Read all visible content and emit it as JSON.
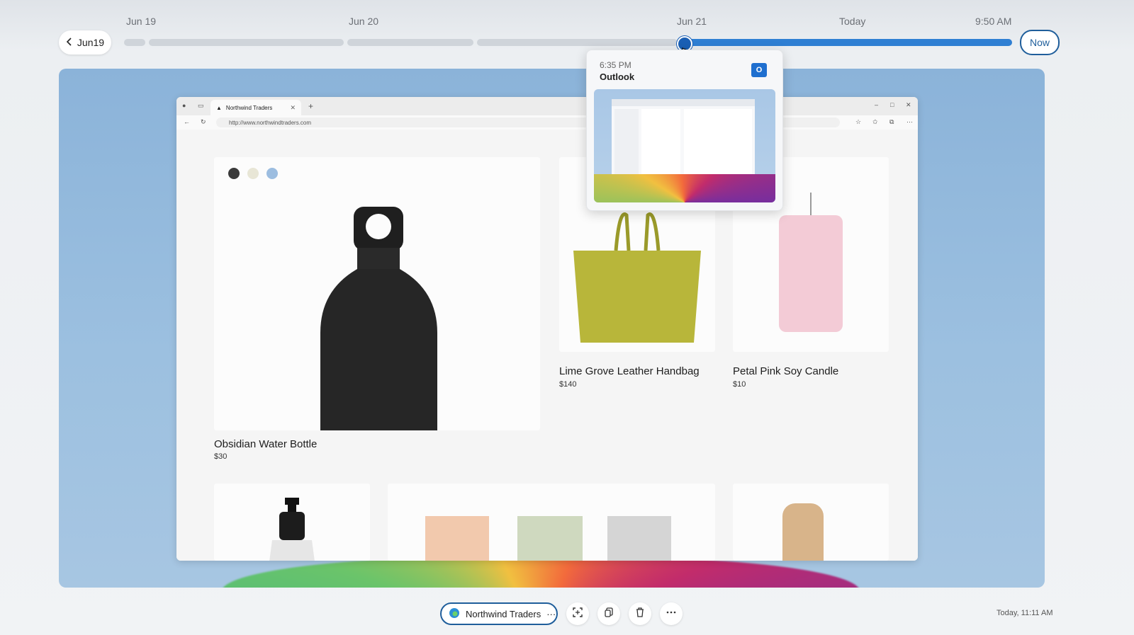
{
  "timeline": {
    "back_label": "Jun19",
    "labels": [
      "Jun 19",
      "Jun 20",
      "Jun 21",
      "Today",
      "9:50 AM"
    ],
    "now_label": "Now"
  },
  "browser": {
    "tab_title": "Northwind Traders",
    "url": "http://www.northwindtraders.com"
  },
  "products": [
    {
      "name": "Obsidian  Water Bottle",
      "price": "$30"
    },
    {
      "name": "Lime Grove Leather Handbag",
      "price": "$140"
    },
    {
      "name": "Petal Pink Soy Candle",
      "price": "$10"
    }
  ],
  "swatches": [
    "#3a3a3a",
    "#e8e6d6",
    "#9cbde0"
  ],
  "popup": {
    "time": "6:35 PM",
    "app": "Outlook",
    "icon": "outlook-icon"
  },
  "bottom_bar": {
    "app_pill_label": "Northwind Traders",
    "more_label": "···",
    "timestamp": "Today, 11:11 AM"
  },
  "colors": {
    "accent": "#2f7fd3",
    "accent_dark": "#1f5e9b"
  }
}
